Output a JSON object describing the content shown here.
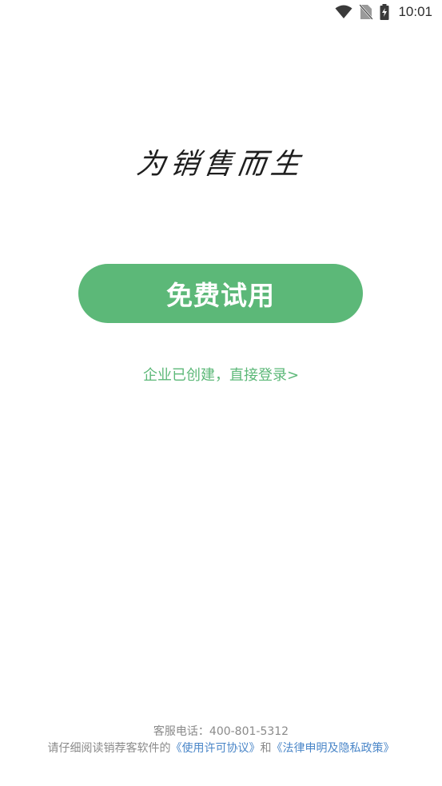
{
  "status_bar": {
    "time": "10:01",
    "icons": [
      "wifi-icon",
      "no-sim-icon",
      "battery-charging-icon"
    ]
  },
  "slogan": "为销售而生",
  "trial_button_label": "免费试用",
  "login_link_label": "企业已创建，直接登录>",
  "footer": {
    "phone_label": "客服电话：",
    "phone_number": "400-801-5312",
    "agreement_prefix": "请仔细阅读销荐客软件的",
    "license_link": "《使用许可协议》",
    "conjunction": "和",
    "legal_link": "《法律申明及隐私政策》"
  },
  "colors": {
    "accent": "#5cb878",
    "link": "#4a86c8",
    "muted_text": "#8a8a8a"
  }
}
